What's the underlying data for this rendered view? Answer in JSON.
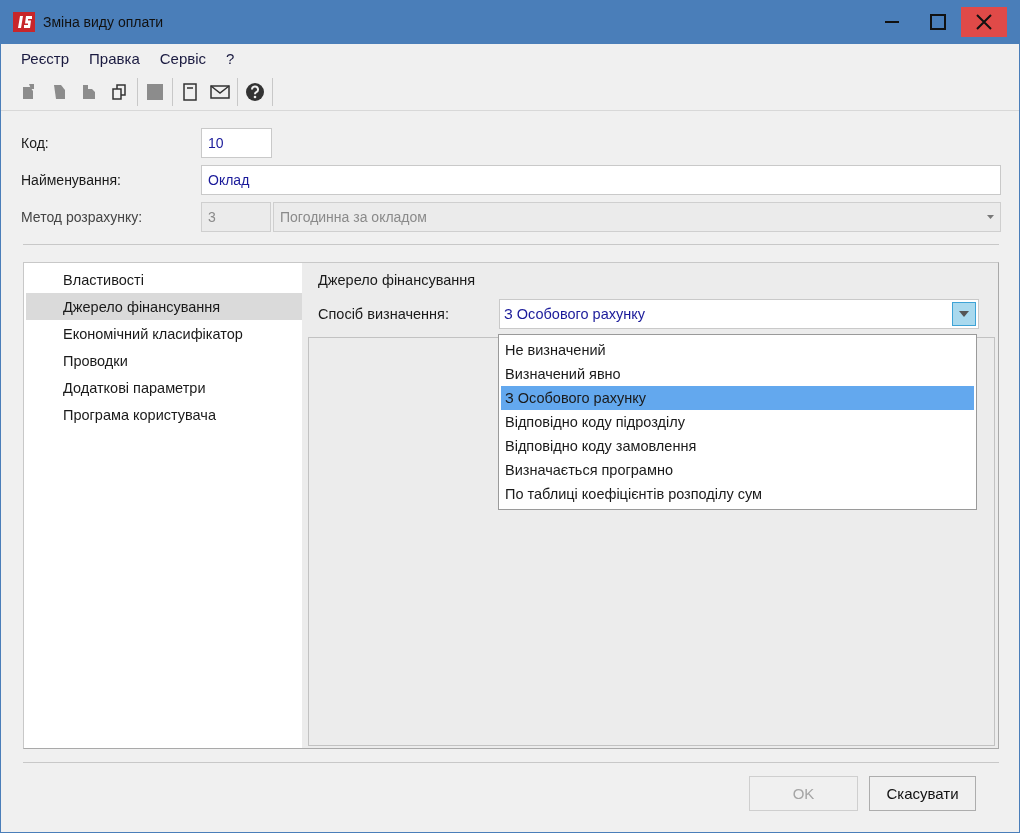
{
  "window": {
    "title": "Зміна виду оплати"
  },
  "menu": [
    "Реєстр",
    "Правка",
    "Сервіс",
    "?"
  ],
  "toolbar": [
    {
      "kind": "add",
      "disabled": true
    },
    {
      "kind": "edit",
      "disabled": true
    },
    {
      "kind": "delete",
      "disabled": true
    },
    {
      "kind": "copy",
      "disabled": false
    },
    {
      "kind": "save",
      "disabled": true
    },
    {
      "kind": "notebook",
      "disabled": false
    },
    {
      "kind": "mail",
      "disabled": false
    },
    {
      "kind": "help",
      "disabled": false
    }
  ],
  "fields": {
    "code": {
      "label": "Код:",
      "value": "10"
    },
    "name": {
      "label": "Найменування:",
      "value": "Оклад"
    },
    "method": {
      "label": "Метод розрахунку:",
      "code": "3",
      "value": "Погодинна за окладом",
      "disabled": true
    }
  },
  "sidebar": {
    "items": [
      {
        "label": "Властивості",
        "selected": false
      },
      {
        "label": "Джерело фінансування",
        "selected": true
      },
      {
        "label": "Економічний класифікатор",
        "selected": false
      },
      {
        "label": "Проводки",
        "selected": false
      },
      {
        "label": "Додаткові параметри",
        "selected": false
      },
      {
        "label": "Програма користувача",
        "selected": false
      }
    ]
  },
  "panel": {
    "heading": "Джерело фінансування",
    "label": "Спосіб визначення:",
    "value": "З Особового рахунку",
    "options": [
      {
        "label": "Не визначений",
        "selected": false
      },
      {
        "label": "Визначений явно",
        "selected": false
      },
      {
        "label": "З Особового рахунку",
        "selected": true
      },
      {
        "label": "Відповідно коду підрозділу",
        "selected": false
      },
      {
        "label": "Відповідно коду замовлення",
        "selected": false
      },
      {
        "label": "Визначається програмно",
        "selected": false
      },
      {
        "label": "По таблиці коефіцієнтів розподілу сум",
        "selected": false
      }
    ]
  },
  "buttons": [
    {
      "label": "OK",
      "disabled": true
    },
    {
      "label": "Скасувати",
      "disabled": false
    }
  ]
}
